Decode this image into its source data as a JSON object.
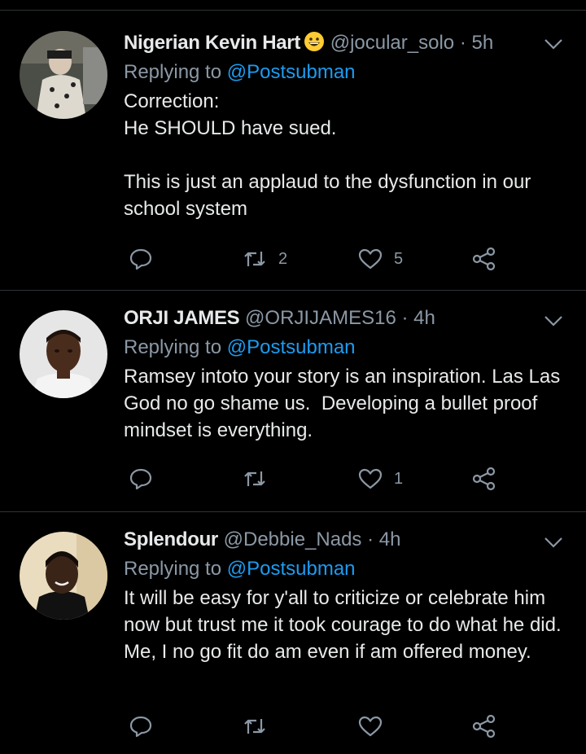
{
  "tweets": [
    {
      "name": "Nigerian Kevin Hart",
      "handle": "@jocular_solo",
      "dot": "·",
      "time": "5h",
      "reply_prefix": "Replying to",
      "reply_to": "@Postsubman",
      "text": "Correction:\nHe SHOULD have sued.\n\nThis is just an applaud to the dysfunction in our school system",
      "retweets": "2",
      "likes": "5",
      "avatar_colors": [
        "#3a3d36",
        "#c8c6bd"
      ]
    },
    {
      "name": "ORJI JAMES",
      "handle": "@ORJIJAMES16",
      "dot": "·",
      "time": "4h",
      "reply_prefix": "Replying to",
      "reply_to": "@Postsubman",
      "text": "Ramsey intoto your story is an inspiration. Las Las God no go shame us.  Developing a bullet proof mindset is everything.",
      "retweets": "",
      "likes": "1",
      "avatar_colors": [
        "#e9e9ea",
        "#4a2c1c"
      ]
    },
    {
      "name": "Splendour",
      "handle": "@Debbie_Nads",
      "dot": "·",
      "time": "4h",
      "reply_prefix": "Replying to",
      "reply_to": "@Postsubman",
      "text": "It will be easy for y'all to criticize or celebrate him now but trust me it took courage to do what he did. Me, I no go fit do am even if am offered money.",
      "retweets": "",
      "likes": "",
      "avatar_colors": [
        "#e8d8b8",
        "#3a2418"
      ]
    }
  ],
  "colors": {
    "accent": "#1d9bf0",
    "muted": "#8b98a5",
    "background": "#000000",
    "divider": "#2f3336"
  },
  "icons": [
    "reply-icon",
    "retweet-icon",
    "like-icon",
    "share-icon",
    "chevron-down-icon",
    "grinning-emoji-icon"
  ]
}
